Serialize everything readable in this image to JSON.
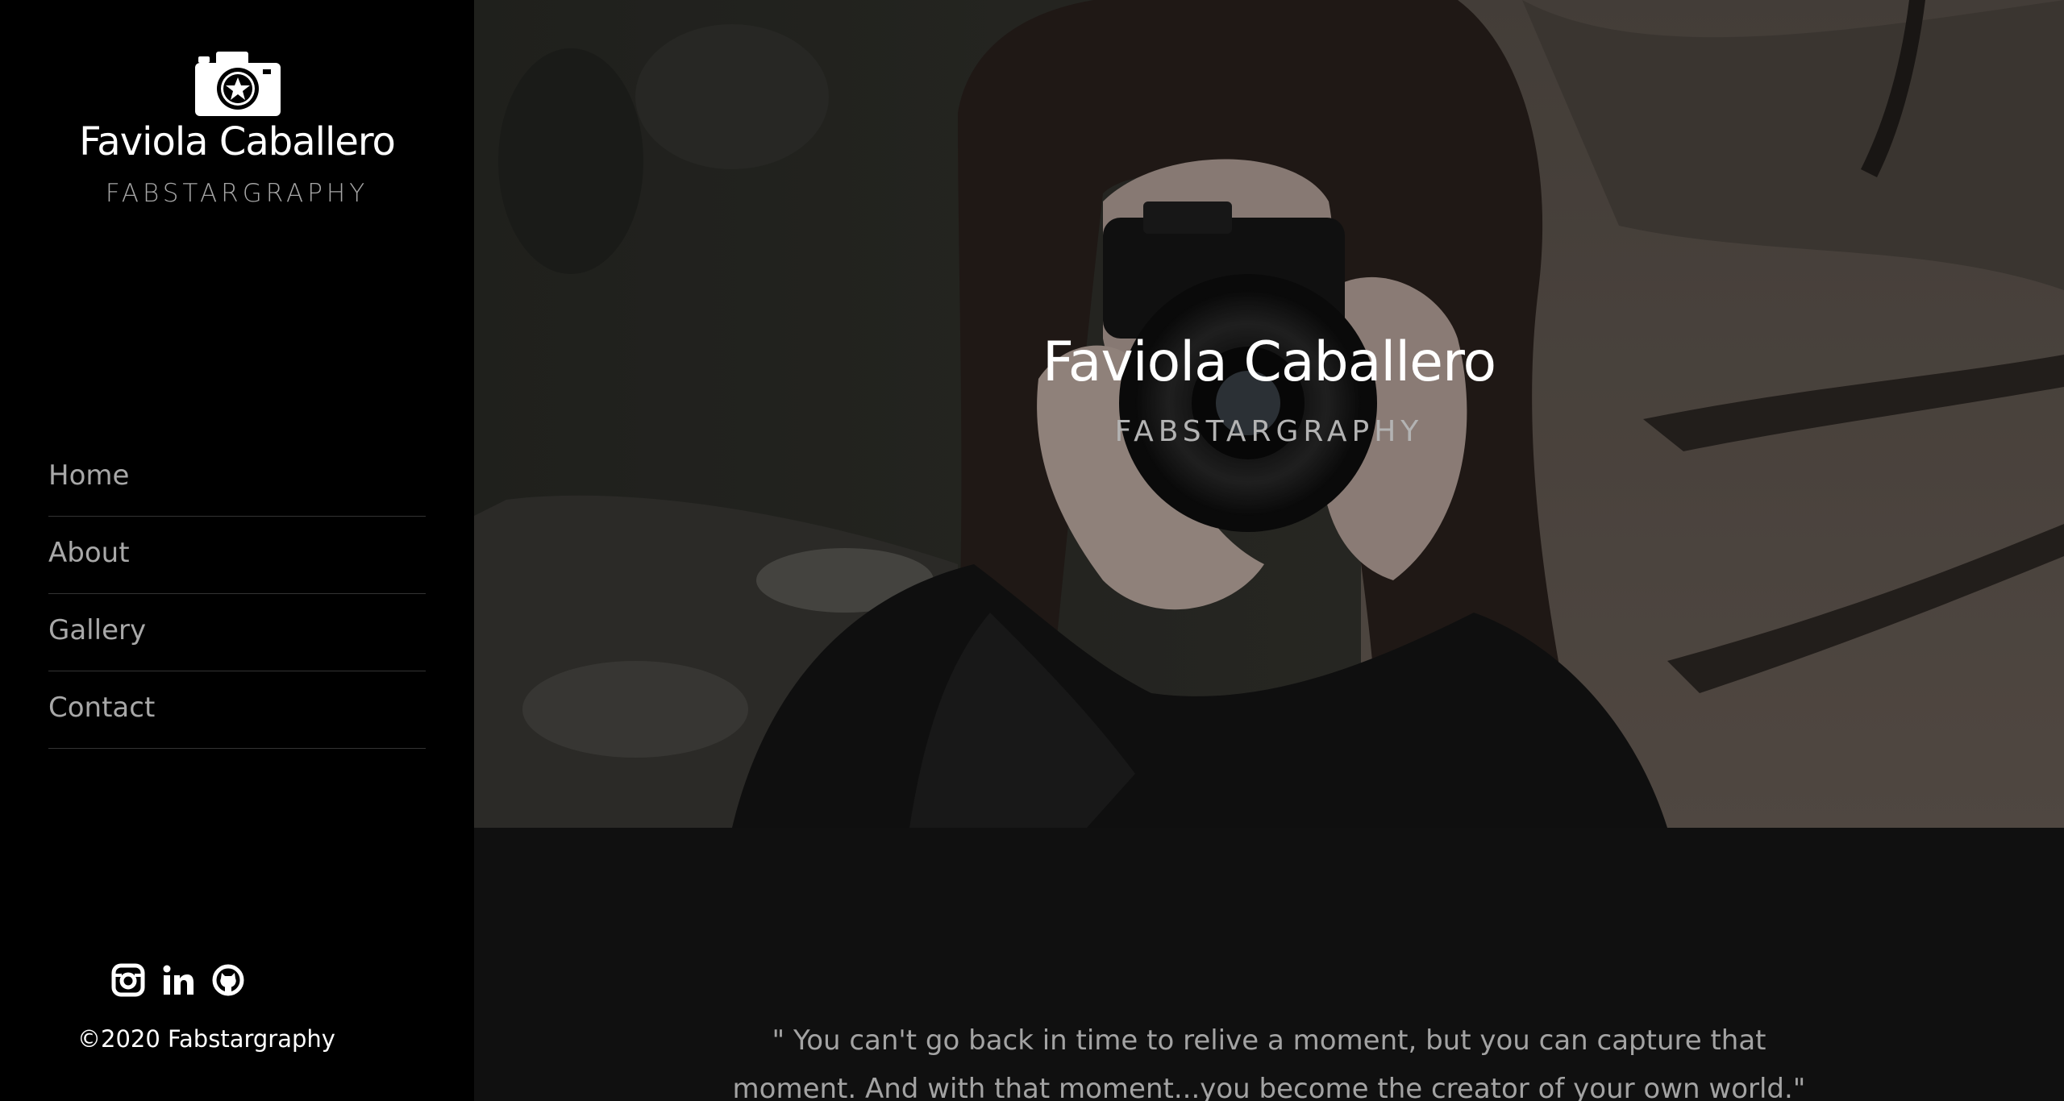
{
  "sidebar": {
    "logo_icon": "camera-star-icon",
    "brand_name": "Faviola Caballero",
    "brand_sub": "FABSTARGRAPHY",
    "nav": [
      {
        "label": "Home"
      },
      {
        "label": "About"
      },
      {
        "label": "Gallery"
      },
      {
        "label": "Contact"
      }
    ],
    "social": [
      {
        "icon": "instagram-icon"
      },
      {
        "icon": "linkedin-icon"
      },
      {
        "icon": "github-icon"
      }
    ],
    "copyright": "©2020 Fabstargraphy"
  },
  "hero": {
    "title": "Faviola Caballero",
    "subtitle": "FABSTARGRAPHY"
  },
  "quote": {
    "text": "\" You can't go back in time to relive a moment, but you can capture that moment. And with that moment...you become the creator of your own world.\""
  },
  "colors": {
    "sidebar_bg": "#000000",
    "section_bg": "#101010",
    "nav_text": "#a8a8a8",
    "divider": "#333333"
  }
}
